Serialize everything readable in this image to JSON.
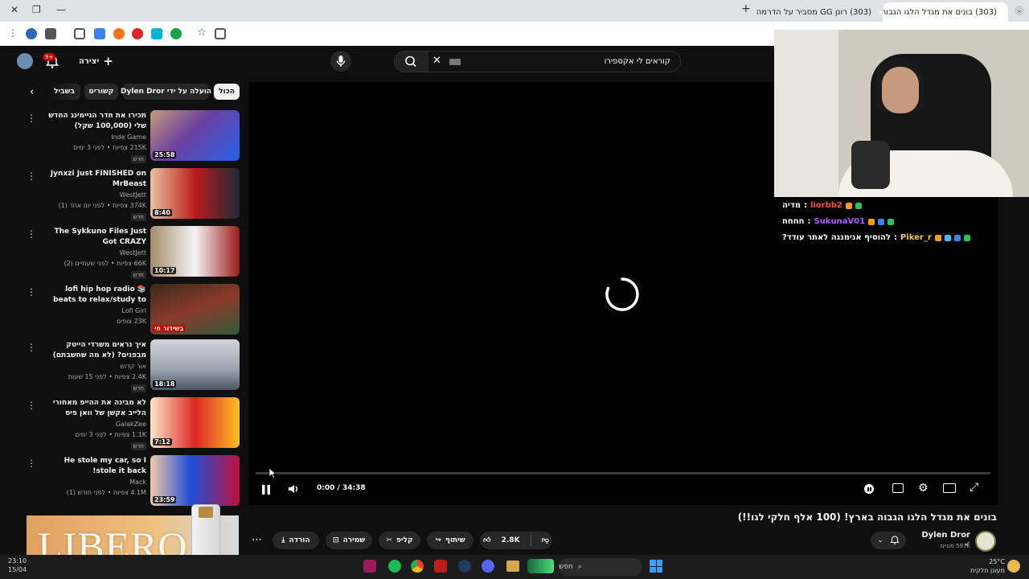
{
  "browser": {
    "tabs": [
      {
        "label": "(303) בונים את מגדל הלגו הגבוה",
        "active": true
      },
      {
        "label": "(303) רונן GG מסביר על הדרמה",
        "active": false
      }
    ],
    "new_tab": "+",
    "window_controls": {
      "minimize": "—",
      "restore": "❐",
      "close": "✕"
    }
  },
  "masthead": {
    "create_label": "יצירה",
    "notif_count": "9+",
    "search_value": "קוראים לי אקספירו",
    "colors": {
      "accent": "#ff0000"
    }
  },
  "chips": [
    "הכול",
    "הועלה על ידי Dylen Dror",
    "קשורים",
    "בשביל"
  ],
  "related": [
    {
      "title": "תכירו את חדר הגיימינג החדש שלי (100,000 שקל)",
      "channel": "Inde Game",
      "meta": "215K צפיות • לפני 3 ימים",
      "badge": "חדש",
      "duration": "25:58"
    },
    {
      "title": "Jynxzi Just FINISHED on MrBeast",
      "channel": "WestJett",
      "meta": "374K צפיות • לפני יום אחד (1)",
      "badge": "חדש",
      "duration": "8:40"
    },
    {
      "title": "The Sykkuno Files Just Got CRAZY",
      "channel": "WestJett",
      "meta": "66K צפיות • לפני שעתיים (2)",
      "badge": "חדש",
      "duration": "10:17"
    },
    {
      "title": "lofi hip hop radio 📚 beats to relax/study to",
      "channel": "Lofi Girl",
      "meta": "23K צופים",
      "badge": "",
      "duration": "בשידור חי"
    },
    {
      "title": "איך נראים משרדי הייטק מבפנים? (לא מה שחשבתם)",
      "channel": "אור קדוש",
      "meta": "2.4K צפיות • לפני 15 שעות",
      "badge": "חדש",
      "duration": "18:18"
    },
    {
      "title": "לא מבינה את ההייפ מאחורי הלייב אקשן של וואן פיס",
      "channel": "GalakZee",
      "meta": "1.1K צפיות • לפני 3 ימים",
      "badge": "חדש",
      "duration": "7:12"
    },
    {
      "title": "He stole my car, so I stole it back!",
      "channel": "Mack",
      "meta": "4.1M צפיות • לפני חודש (1)",
      "badge": "",
      "duration": "23:59"
    }
  ],
  "player": {
    "time": "0:00 / 34:38",
    "progress": 0.0
  },
  "video": {
    "title": "בונים את מגדל הלגו הגבוה בארץ! (100 אלף חלקי לגו!!)",
    "channel": "Dylen Dror",
    "subscribers": "597K מנויים",
    "likes": "2.8K",
    "share": "שיתוף",
    "clip": "קליפ",
    "save": "שמירה",
    "download": "הורדה"
  },
  "overlay": {
    "chat": [
      {
        "user": "liorbb2",
        "message": "מדיה",
        "color": "#ff4d4d"
      },
      {
        "user": "SukunaV01",
        "message": "חחחח",
        "color": "#b45cff"
      },
      {
        "user": "Piker_r",
        "message": "להוסיף אנימנגה לאתר עודד?",
        "color": "#f2c94c"
      }
    ],
    "ad_text": "LIBERO"
  },
  "taskbar": {
    "search": "חפש",
    "time": "23:10",
    "date": "15/04",
    "weather": "25°C",
    "weather_desc": "מעונן חלקית"
  }
}
